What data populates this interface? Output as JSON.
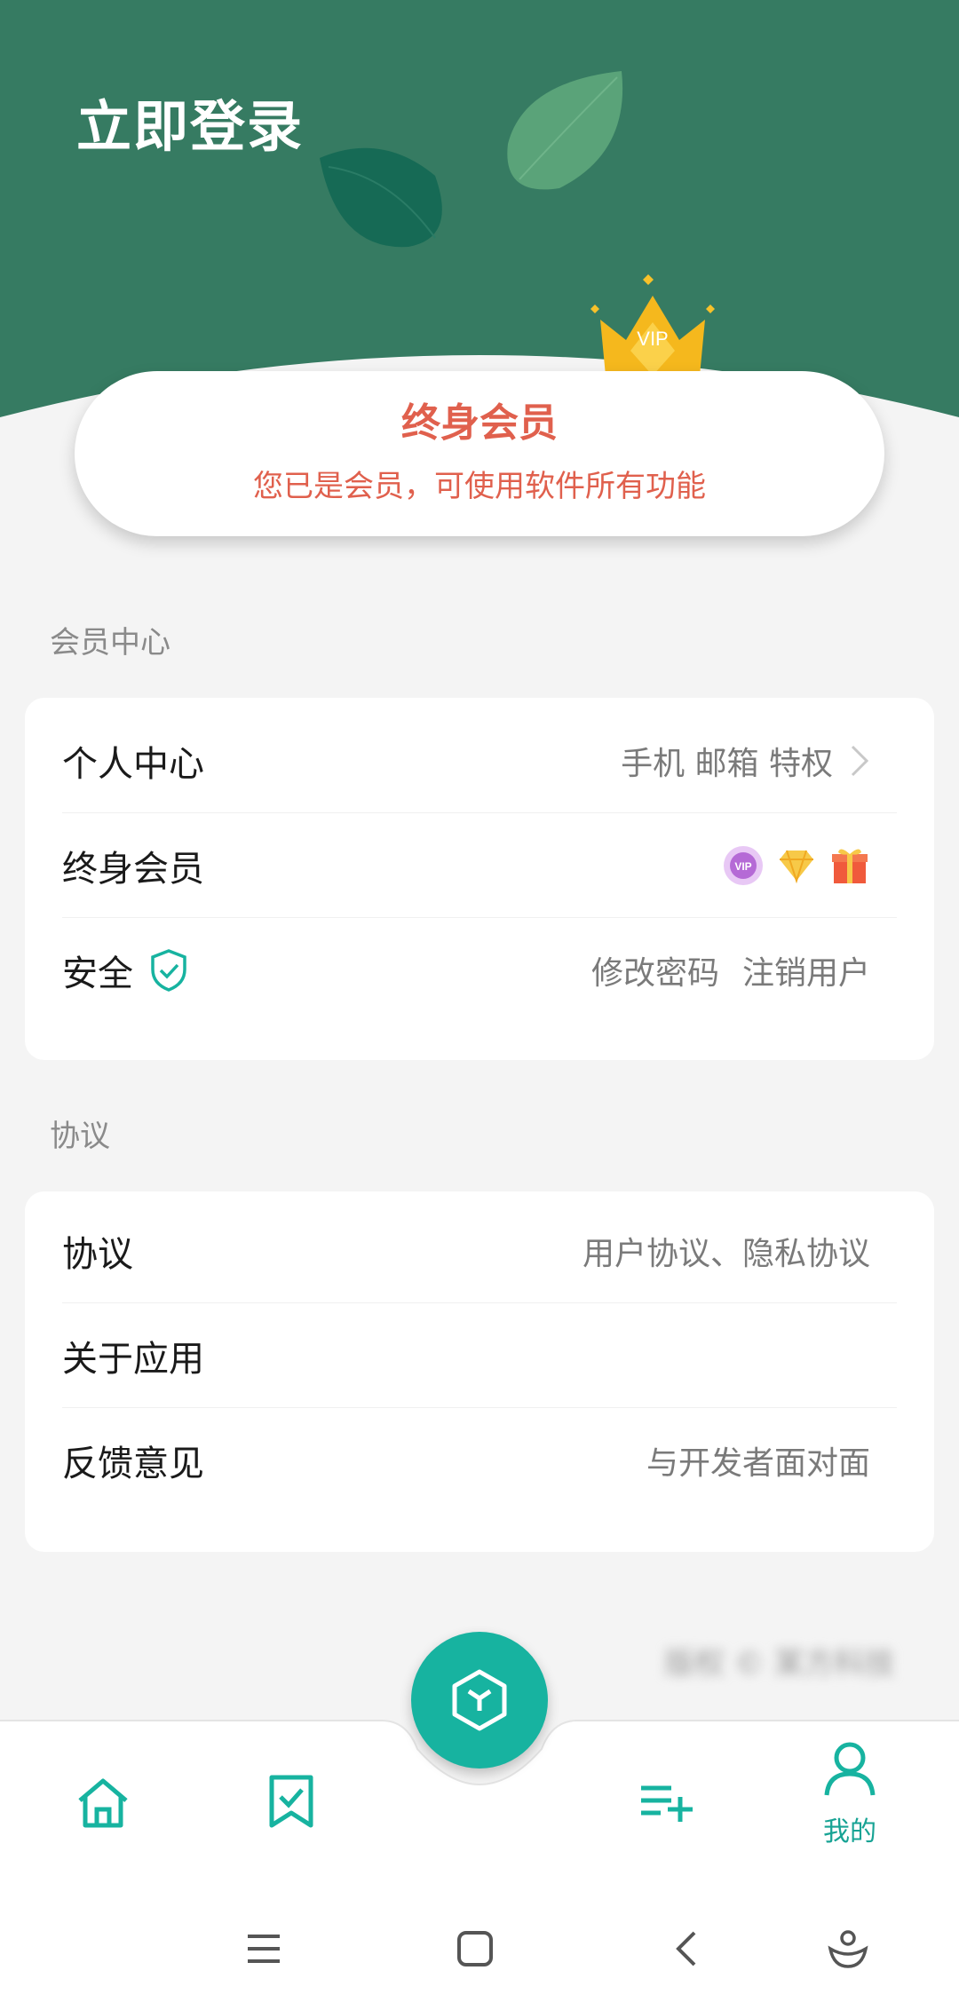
{
  "header": {
    "login_title": "立即登录"
  },
  "member_card": {
    "title": "终身会员",
    "subtitle": "您已是会员，可使用软件所有功能",
    "crown_text": "VIP"
  },
  "member_center": {
    "section_title": "会员中心",
    "rows": [
      {
        "label": "个人中心",
        "right": "手机 邮箱 特权",
        "icon": "chevron-right-icon"
      },
      {
        "label": "终身会员",
        "badges": [
          "vip-badge-icon",
          "diamond-icon",
          "gift-icon"
        ],
        "vip_badge_text": "VIP"
      },
      {
        "label": "安全",
        "label_icon": "shield-check-icon",
        "right_a": "修改密码",
        "right_b": "注销用户"
      }
    ]
  },
  "agreement": {
    "section_title": "协议",
    "rows": [
      {
        "label": "协议",
        "right": "用户协议、隐私协议"
      },
      {
        "label": "关于应用",
        "right": ""
      },
      {
        "label": "反馈意见",
        "right": "与开发者面对面"
      }
    ]
  },
  "footer_blurred": "版权 © 某方科技",
  "bottom_nav": {
    "items": [
      {
        "icon": "home-icon"
      },
      {
        "icon": "bookmark-check-icon"
      },
      {
        "icon": "cube-icon"
      },
      {
        "icon": "playlist-add-icon"
      },
      {
        "icon": "user-icon",
        "label": "我的"
      }
    ]
  },
  "system_nav": [
    "menu-icon",
    "home-square-icon",
    "back-icon",
    "assistant-icon"
  ],
  "colors": {
    "header_green": "#367b62",
    "accent_teal": "#17b3a0",
    "member_red": "#e0604d"
  }
}
